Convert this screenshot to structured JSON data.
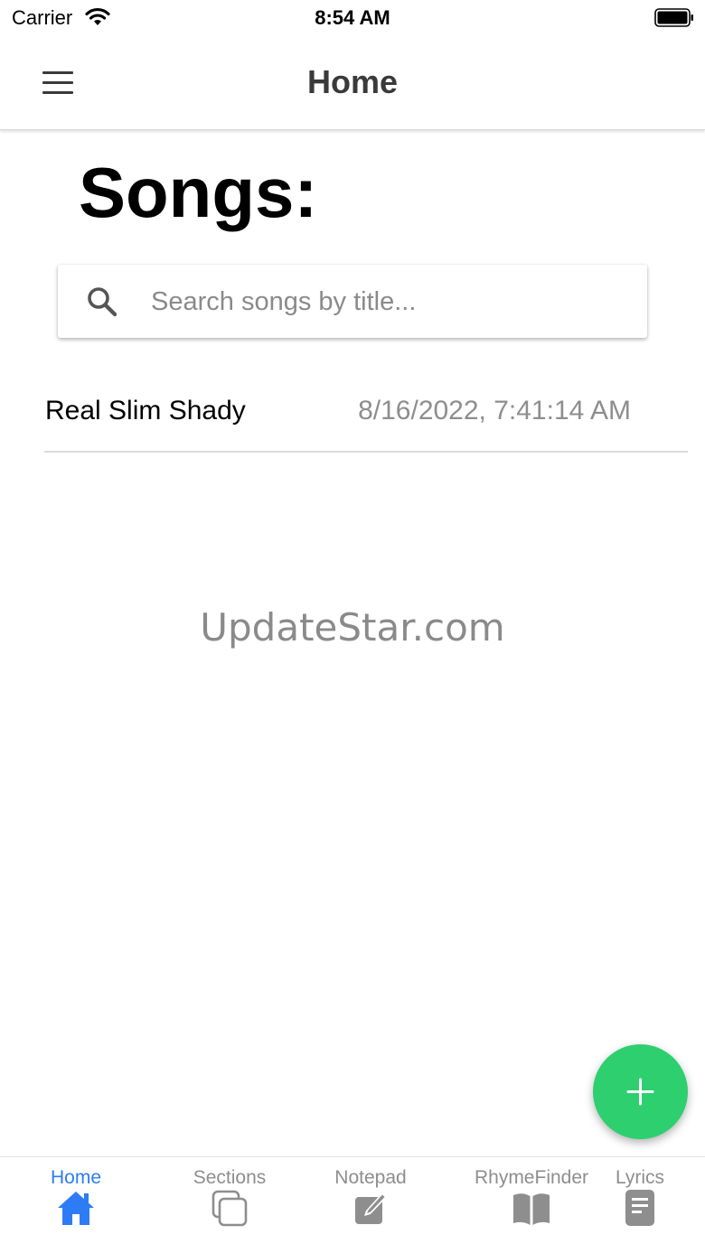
{
  "status_bar": {
    "carrier": "Carrier",
    "time": "8:54 AM",
    "icons": [
      "wifi-icon",
      "battery-icon"
    ]
  },
  "header": {
    "title": "Home",
    "menu_icon": "hamburger-menu-icon"
  },
  "main": {
    "title": "Songs:",
    "search": {
      "placeholder": "Search songs by title...",
      "value": "",
      "icon": "search-icon"
    },
    "songs": [
      {
        "title": "Real Slim Shady",
        "date": "8/16/2022, 7:41:14 AM"
      }
    ]
  },
  "watermark": "UpdateStar.com",
  "fab": {
    "icon": "plus-icon"
  },
  "tab_bar": {
    "active": "Home",
    "tabs": [
      {
        "label": "Home",
        "icon": "home-icon"
      },
      {
        "label": "Sections",
        "icon": "copy-icon"
      },
      {
        "label": "Notepad",
        "icon": "edit-icon"
      },
      {
        "label": "RhymeFinder",
        "icon": "book-icon"
      },
      {
        "label": "Lyrics",
        "icon": "document-icon"
      }
    ]
  },
  "colors": {
    "accent": "#2d7cf6",
    "fab": "#2ecf6f",
    "inactive_tab": "#8e8e8e",
    "header_text": "#3a3a3a"
  }
}
